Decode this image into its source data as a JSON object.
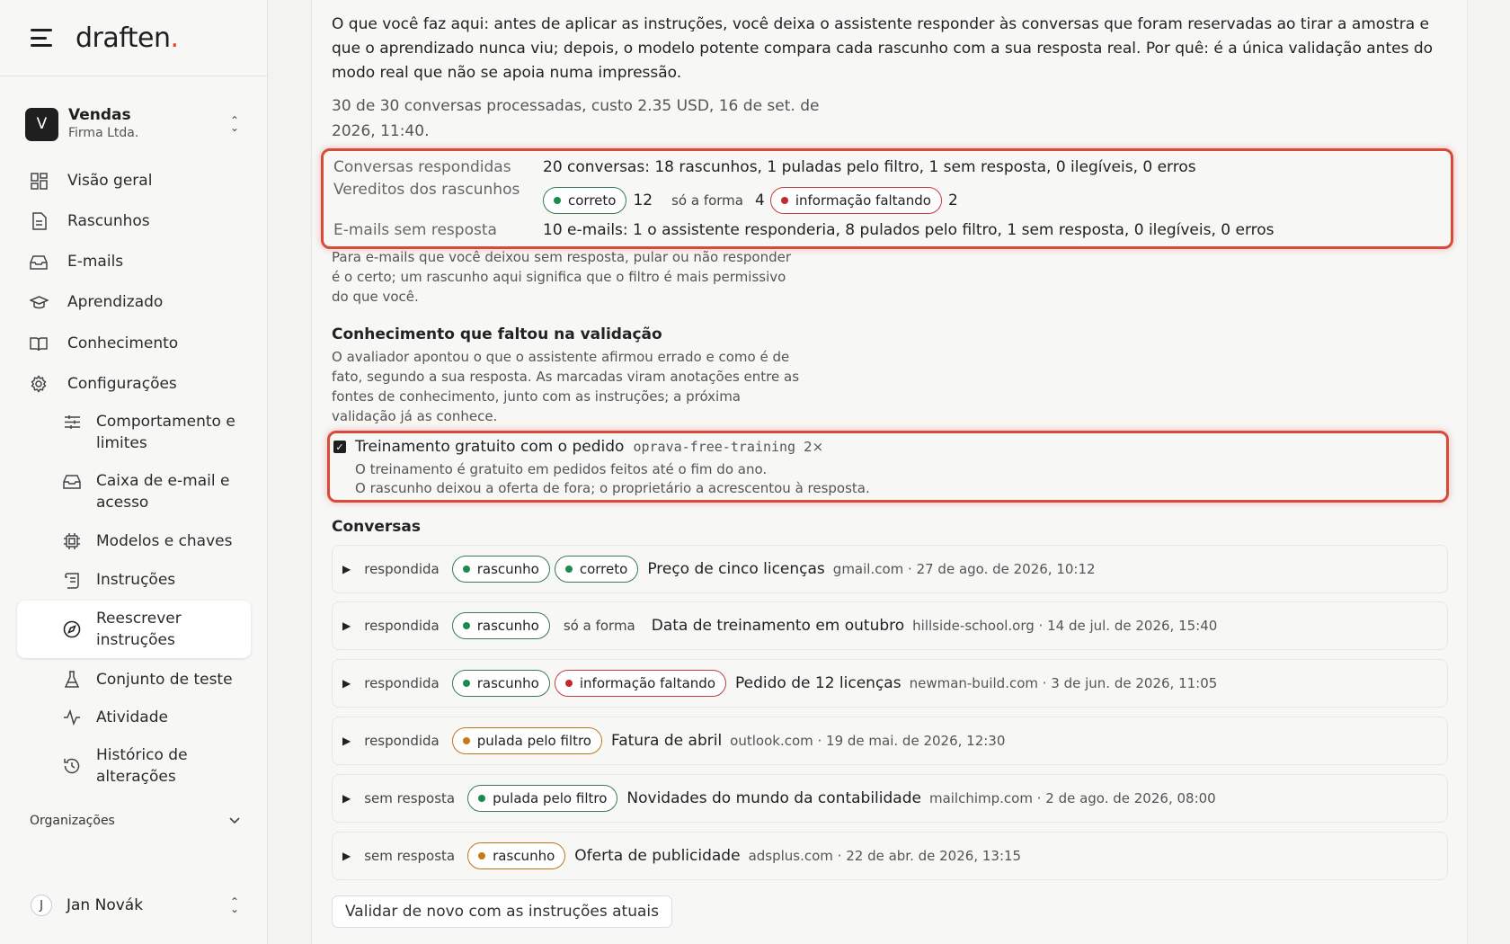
{
  "brand": {
    "name": "draften",
    "dot": "."
  },
  "workspace": {
    "initial": "V",
    "name": "Vendas",
    "org": "Firma Ltda."
  },
  "nav": {
    "items": [
      {
        "label": "Visão geral",
        "icon": "grid-icon"
      },
      {
        "label": "Rascunhos",
        "icon": "document-icon"
      },
      {
        "label": "E-mails",
        "icon": "inbox-icon"
      },
      {
        "label": "Aprendizado",
        "icon": "graduation-cap-icon"
      },
      {
        "label": "Conhecimento",
        "icon": "book-icon"
      },
      {
        "label": "Configurações",
        "icon": "gear-icon"
      }
    ],
    "sub_items": [
      {
        "label": "Comportamento e limites",
        "icon": "sliders-icon"
      },
      {
        "label": "Caixa de e-mail e acesso",
        "icon": "inbox-icon"
      },
      {
        "label": "Modelos e chaves",
        "icon": "chip-icon"
      },
      {
        "label": "Instruções",
        "icon": "scroll-icon"
      },
      {
        "label": "Reescrever instruções",
        "icon": "compass-icon",
        "active": true
      },
      {
        "label": "Conjunto de teste",
        "icon": "flask-icon"
      },
      {
        "label": "Atividade",
        "icon": "activity-icon"
      },
      {
        "label": "Histórico de alterações",
        "icon": "history-icon"
      }
    ]
  },
  "organizations": {
    "label": "Organizações"
  },
  "user": {
    "initial": "J",
    "name": "Jan Novák"
  },
  "intro_text": "O que você faz aqui: antes de aplicar as instruções, você deixa o assistente responder às conversas que foram reservadas ao tirar a amostra e que o aprendizado nunca viu; depois, o modelo potente compara cada rascunho com a sua resposta real. Por quê: é a única validação antes do modo real que não se apoia numa impressão.",
  "meta_text": "30 de 30 conversas processadas, custo 2.35 USD, 16 de set. de 2026, 11:40.",
  "stats": {
    "answered_label": "Conversas respondidas",
    "answered_value": "20 conversas: 18 rascunhos, 1 puladas pelo filtro, 1 sem resposta, 0 ilegíveis, 0 erros",
    "verdicts_label": "Vereditos dos rascunhos",
    "verdicts": [
      {
        "label": "correto",
        "count": "12",
        "style": "green"
      },
      {
        "label": "só a forma",
        "count": "4",
        "style": "plain"
      },
      {
        "label": "informação faltando",
        "count": "2",
        "style": "red"
      }
    ],
    "unanswered_label": "E-mails sem resposta",
    "unanswered_value": "10 e-mails: 1 o assistente responderia, 8 pulados pelo filtro, 1 sem resposta, 0 ilegíveis, 0 erros"
  },
  "note_text": "Para e-mails que você deixou sem resposta, pular ou não responder é o certo; um rascunho aqui significa que o filtro é mais permissivo do que você.",
  "knowledge": {
    "title": "Conhecimento que faltou na validação",
    "description": "O avaliador apontou o que o assistente afirmou errado e como é de fato, segundo a sua resposta. As marcadas viram anotações entre as fontes de conhecimento, junto com as instruções; a próxima validação já as conhece.",
    "item": {
      "checked": true,
      "name": "Treinamento gratuito com o pedido",
      "code": "oprava-free-training",
      "count": "2×",
      "line1": "O treinamento é gratuito em pedidos feitos até o fim do ano.",
      "line2": "O rascunho deixou a oferta de fora; o proprietário a acrescentou à resposta."
    }
  },
  "conversations": {
    "title": "Conversas",
    "items": [
      {
        "status": "respondida",
        "tags": [
          {
            "label": "rascunho",
            "style": "green"
          },
          {
            "label": "correto",
            "style": "green"
          }
        ],
        "subject": "Preço de cinco licenças",
        "meta": "gmail.com · 27 de ago. de 2026, 10:12"
      },
      {
        "status": "respondida",
        "tags": [
          {
            "label": "rascunho",
            "style": "green"
          },
          {
            "label": "só a forma",
            "style": "plain"
          }
        ],
        "subject": "Data de treinamento em outubro",
        "meta": "hillside-school.org · 14 de jul. de 2026, 15:40"
      },
      {
        "status": "respondida",
        "tags": [
          {
            "label": "rascunho",
            "style": "green"
          },
          {
            "label": "informação faltando",
            "style": "red"
          }
        ],
        "subject": "Pedido de 12 licenças",
        "meta": "newman-build.com · 3 de jun. de 2026, 11:05"
      },
      {
        "status": "respondida",
        "tags": [
          {
            "label": "pulada pelo filtro",
            "style": "orange"
          }
        ],
        "subject": "Fatura de abril",
        "meta": "outlook.com · 19 de mai. de 2026, 12:30"
      },
      {
        "status": "sem resposta",
        "tags": [
          {
            "label": "pulada pelo filtro",
            "style": "green"
          }
        ],
        "subject": "Novidades do mundo da contabilidade",
        "meta": "mailchimp.com · 2 de ago. de 2026, 08:00"
      },
      {
        "status": "sem resposta",
        "tags": [
          {
            "label": "rascunho",
            "style": "orange"
          }
        ],
        "subject": "Oferta de publicidade",
        "meta": "adsplus.com · 22 de abr. de 2026, 13:15"
      }
    ]
  },
  "revalidate_label": "Validar de novo com as instruções atuais",
  "colors": {
    "accent_red": "#d94a38",
    "tag_green": "#1d8a4e",
    "tag_red": "#c42a2a",
    "tag_orange": "#c77a12",
    "brand_dot": "#e8462a"
  }
}
